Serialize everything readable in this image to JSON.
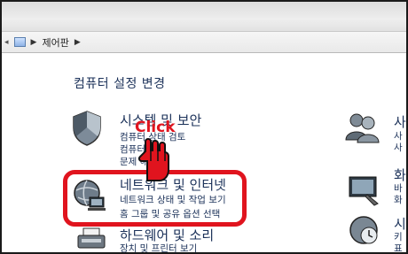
{
  "breadcrumb": {
    "location": "제어판"
  },
  "heading": "컴퓨터 설정 변경",
  "categories": [
    {
      "title": "시스템 및 보안",
      "links": [
        "컴퓨터 상태 검토",
        "컴퓨터",
        "문제 해결"
      ]
    },
    {
      "title": "네트워크 및 인터넷",
      "links": [
        "네트워크 상태 및 작업 보기",
        "홈 그룹 및 공유 옵션 선택"
      ]
    },
    {
      "title": "하드웨어 및 소리",
      "links": [
        "장치 및 프린터 보기"
      ]
    }
  ],
  "right_categories": [
    {
      "title": "사",
      "links": [
        "사",
        "사"
      ]
    },
    {
      "title": "화",
      "links": [
        "바",
        "화"
      ]
    },
    {
      "title": "시",
      "links": [
        "키",
        "표"
      ]
    }
  ],
  "annotation": {
    "click_label": "Click"
  },
  "colors": {
    "highlight": "#e0141e",
    "link_text": "#1b3159"
  }
}
